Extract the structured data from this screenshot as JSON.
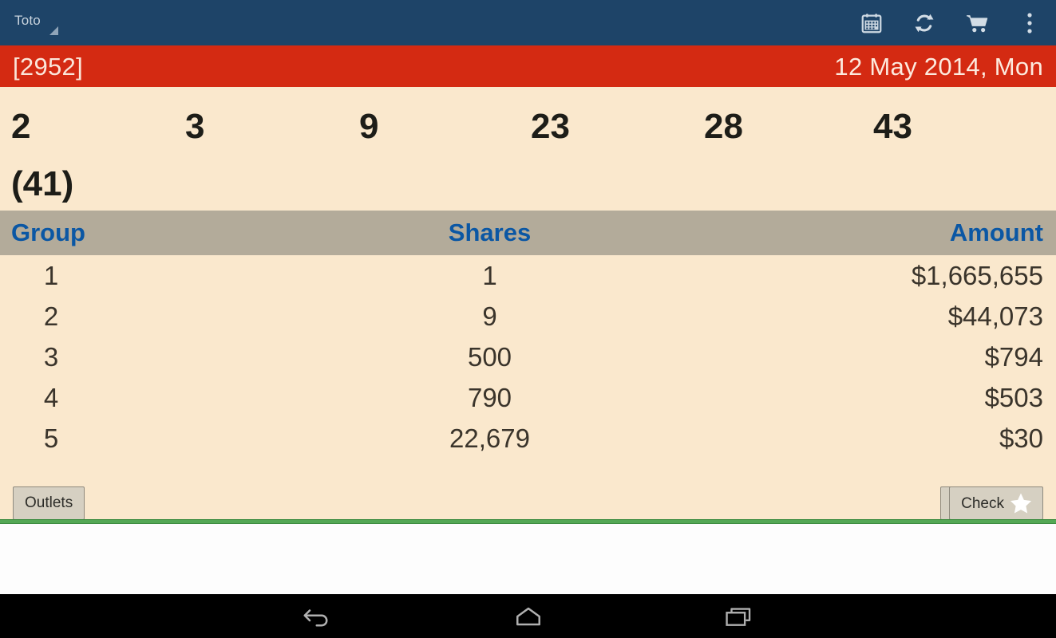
{
  "actionbar": {
    "spinner_label": "Toto",
    "icons": [
      {
        "name": "calendar-icon",
        "label": "Calendar"
      },
      {
        "name": "refresh-icon",
        "label": "Refresh"
      },
      {
        "name": "cart-icon",
        "label": "Cart"
      },
      {
        "name": "overflow-menu-icon",
        "label": "More options"
      }
    ]
  },
  "drawbar": {
    "draw_id": "[2952]",
    "draw_date": "12 May 2014, Mon"
  },
  "draw": {
    "winning_numbers": [
      "2",
      "3",
      "9",
      "23",
      "28",
      "43"
    ],
    "additional_number": "(41)"
  },
  "table": {
    "headers": {
      "group": "Group",
      "shares": "Shares",
      "amount": "Amount"
    },
    "rows": [
      {
        "group": "1",
        "shares": "1",
        "amount": "$1,665,655"
      },
      {
        "group": "2",
        "shares": "9",
        "amount": "$44,073"
      },
      {
        "group": "3",
        "shares": "500",
        "amount": "$794"
      },
      {
        "group": "4",
        "shares": "790",
        "amount": "$503"
      },
      {
        "group": "5",
        "shares": "22,679",
        "amount": "$30"
      }
    ]
  },
  "buttons": {
    "outlets": "Outlets",
    "favourite_icon": "star-pencil-icon",
    "check": "Check",
    "check_icon": "star-icon"
  },
  "navbar": {
    "back": "back-icon",
    "home": "home-icon",
    "recents": "recents-icon"
  },
  "colors": {
    "actionbar": "#1e4468",
    "drawbar_red": "#d42a12",
    "cream": "#fae8cd",
    "table_header": "#b3ab9a",
    "header_text_blue": "#0b57a4",
    "divider_green": "#54a855",
    "star_gold": "#e8a530"
  }
}
